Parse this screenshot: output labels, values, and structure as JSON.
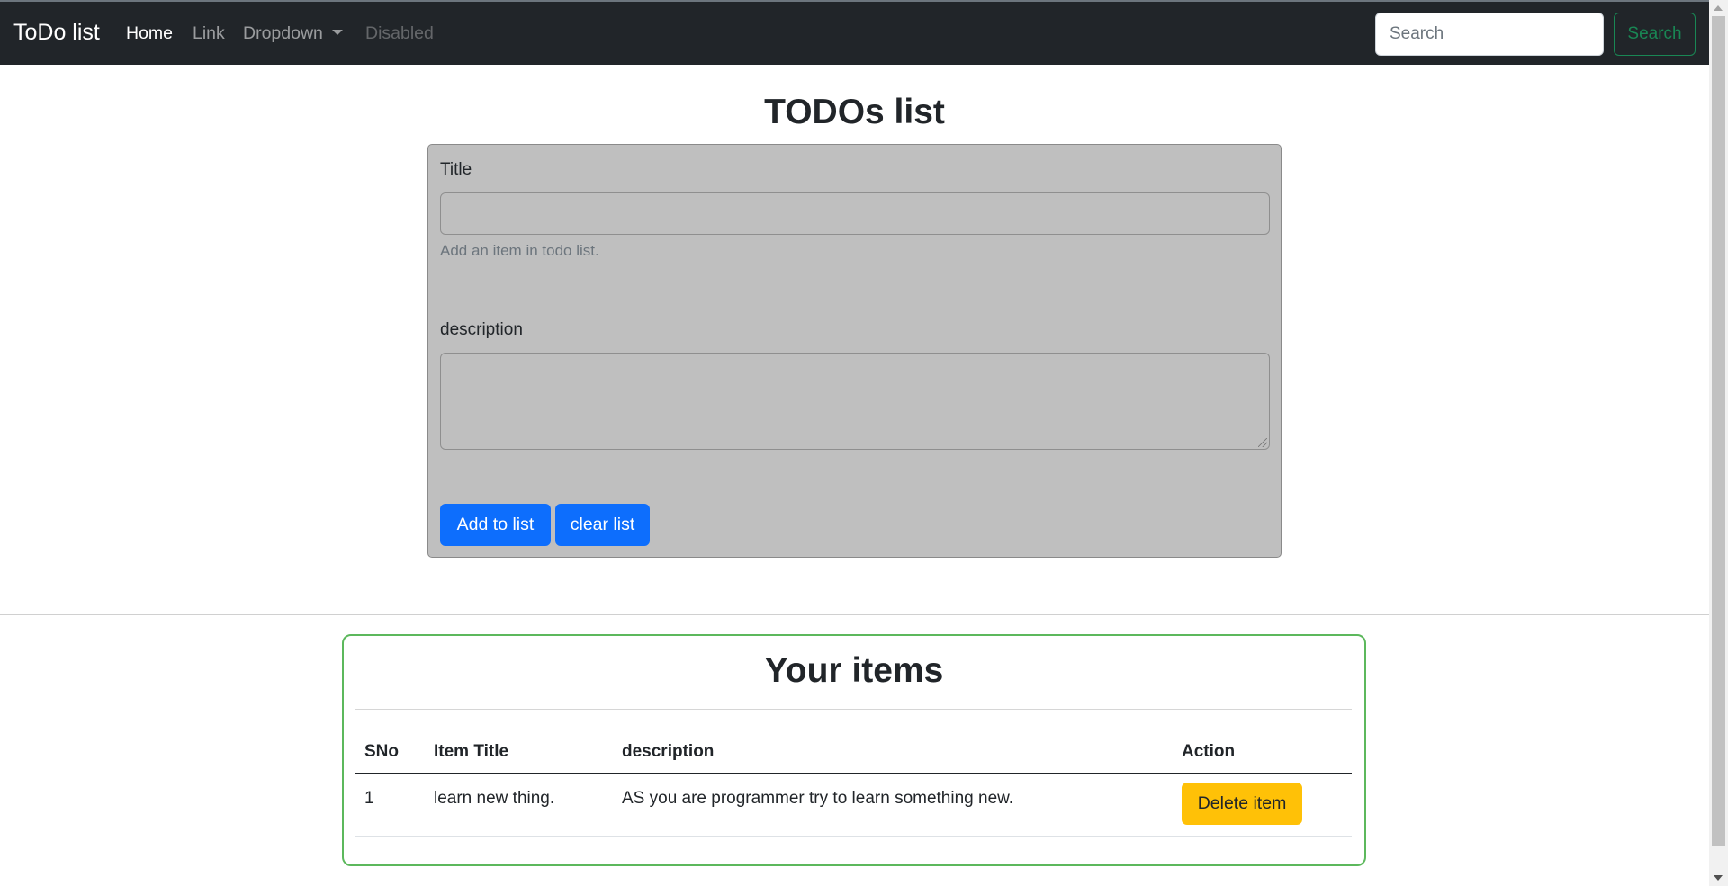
{
  "navbar": {
    "brand": "ToDo list",
    "links": [
      {
        "label": "Home",
        "state": "active"
      },
      {
        "label": "Link",
        "state": "normal"
      },
      {
        "label": "Dropdown",
        "state": "dropdown"
      },
      {
        "label": "Disabled",
        "state": "disabled"
      }
    ],
    "search_placeholder": "Search",
    "search_button": "Search"
  },
  "form": {
    "heading": "TODOs list",
    "title_label": "Title",
    "title_value": "",
    "title_help": "Add an item in todo list.",
    "description_label": "description",
    "description_value": "",
    "add_button": "Add to list",
    "clear_button": "clear list"
  },
  "items": {
    "heading": "Your items",
    "columns": [
      "SNo",
      "Item Title",
      "description",
      "Action"
    ],
    "rows": [
      {
        "sno": "1",
        "title": "learn new thing.",
        "description": "AS you are programmer try to learn something new.",
        "action": "Delete item"
      }
    ]
  },
  "colors": {
    "navbar_bg": "#212529",
    "primary": "#0d6efd",
    "success": "#198754",
    "warning": "#ffc107",
    "form_bg": "#bfbfbf",
    "items_border": "#5cb85c"
  }
}
